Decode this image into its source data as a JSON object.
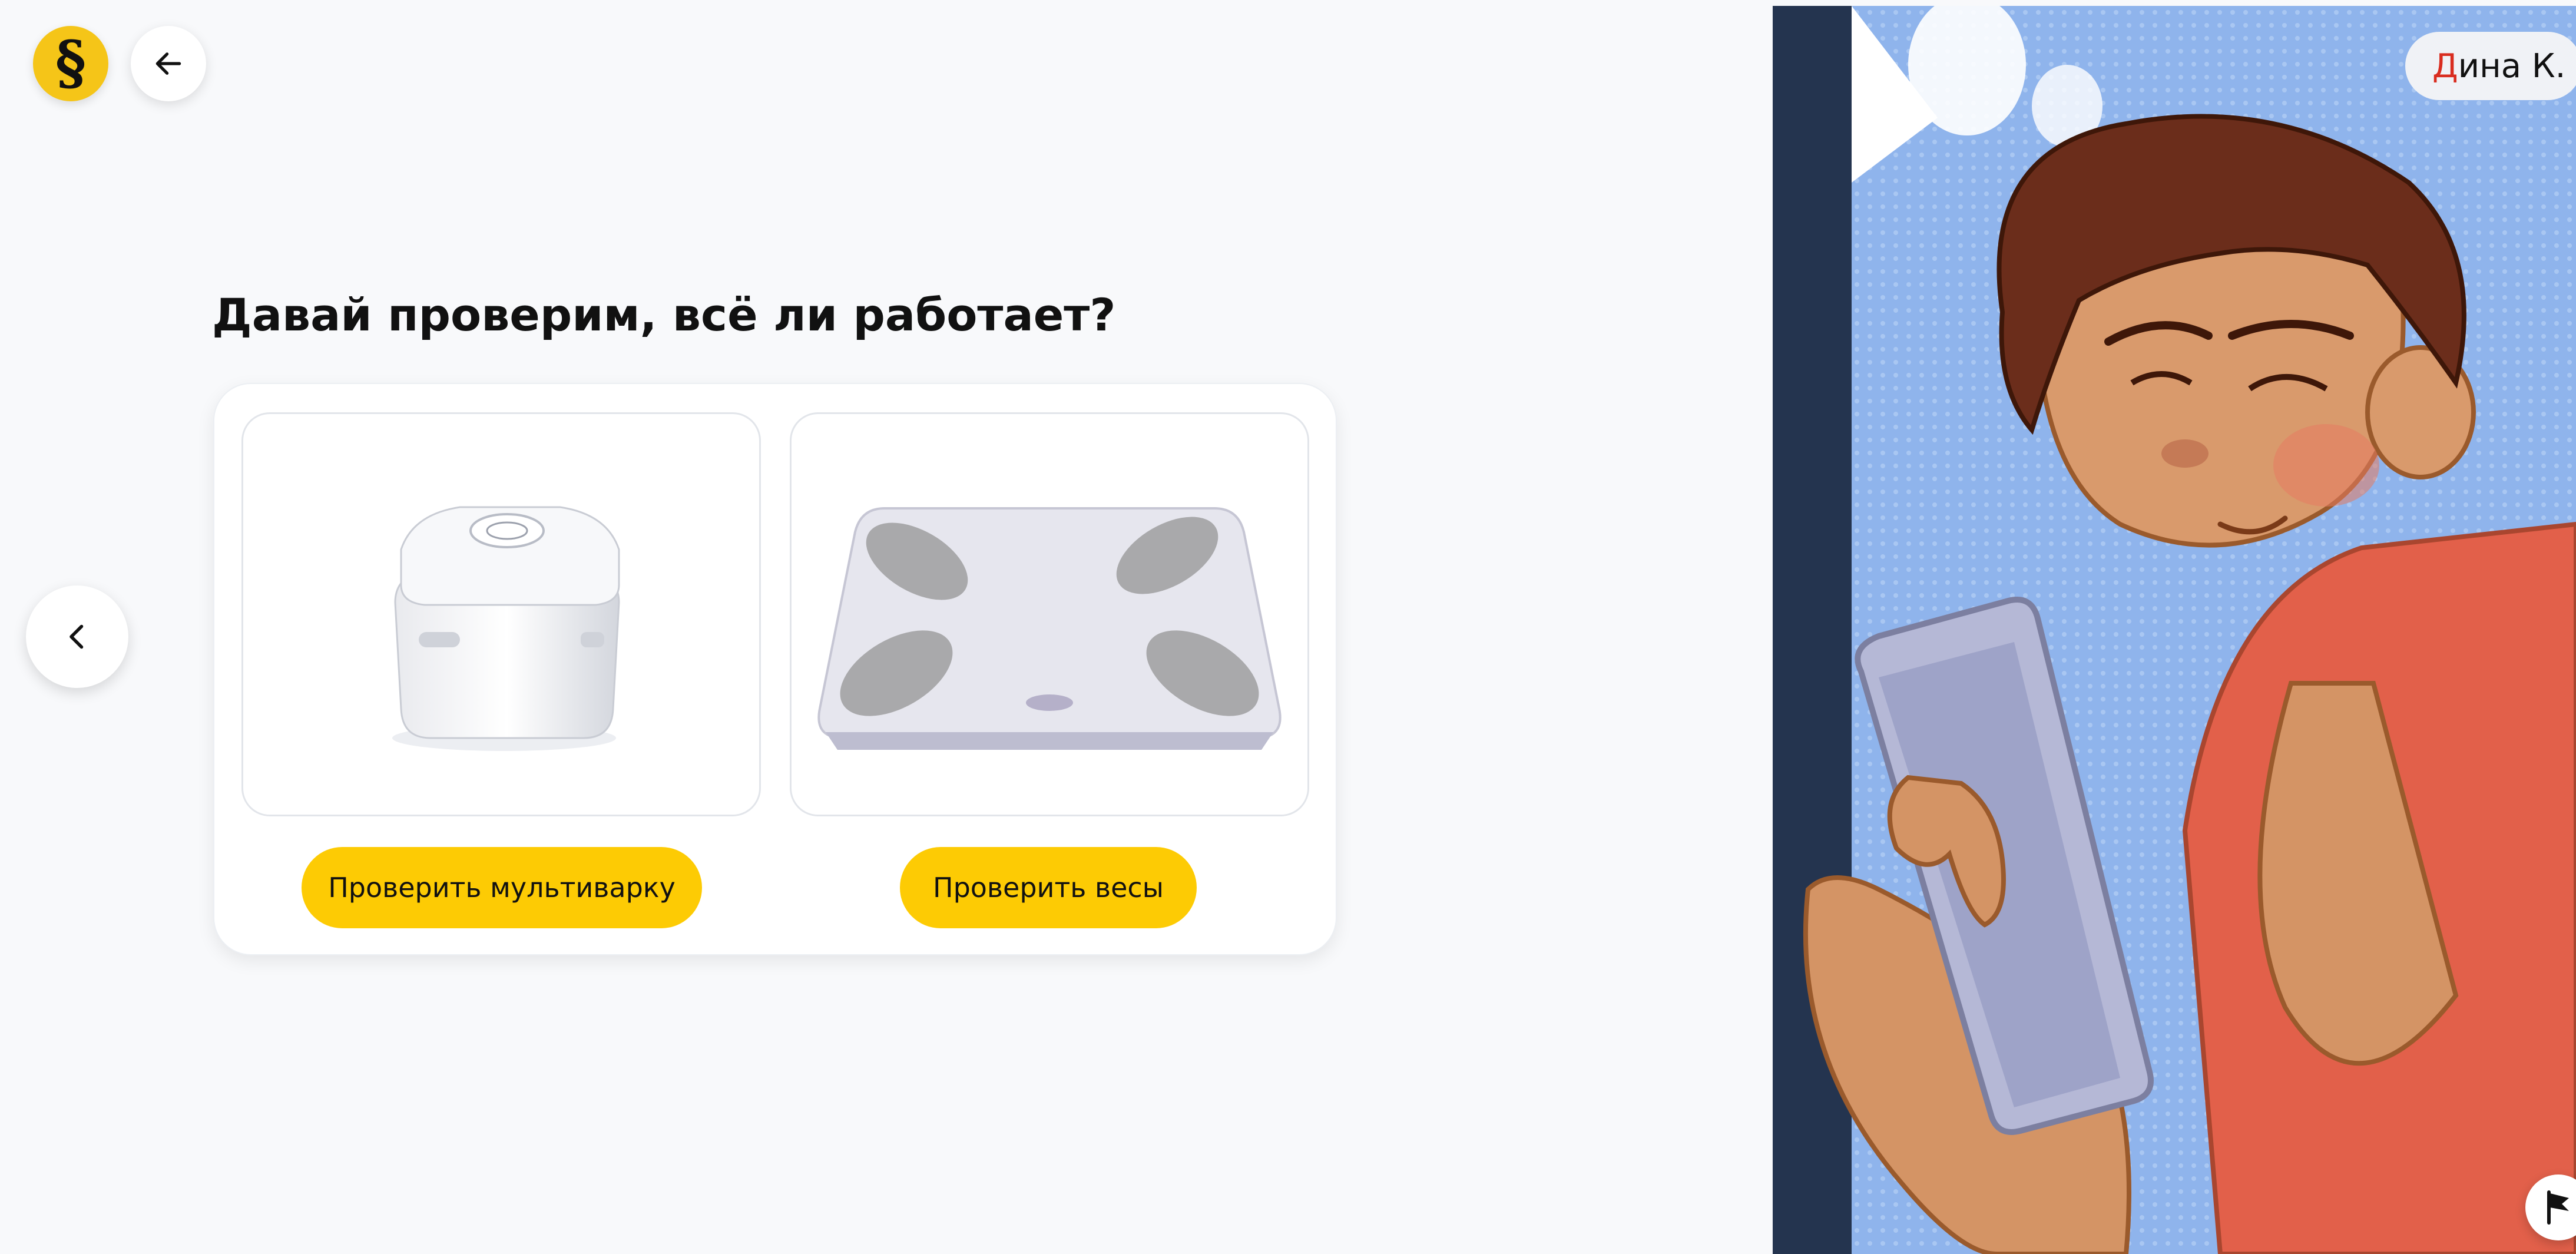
{
  "header": {
    "logo_glyph": "§",
    "back_icon": "arrow-left-icon"
  },
  "main": {
    "title": "Давай проверим, всё ли работает?",
    "items": [
      {
        "label": "Проверить мультиварку",
        "image": "multicooker"
      },
      {
        "label": "Проверить весы",
        "image": "bathroom-scale"
      }
    ],
    "prev_icon": "chevron-left-icon"
  },
  "user": {
    "name_first_letter": "Д",
    "name_rest": "ина К."
  },
  "colors": {
    "accent": "#fdcb04",
    "logo": "#f5c518",
    "name_initial": "#d92d20",
    "illustration_bg": "#8fb4ec",
    "illustration_dark": "#24344f",
    "shirt": "#e2604a"
  },
  "illustration": {
    "subject": "boy-looking-at-tablet",
    "flag_icon": "flag-icon"
  }
}
